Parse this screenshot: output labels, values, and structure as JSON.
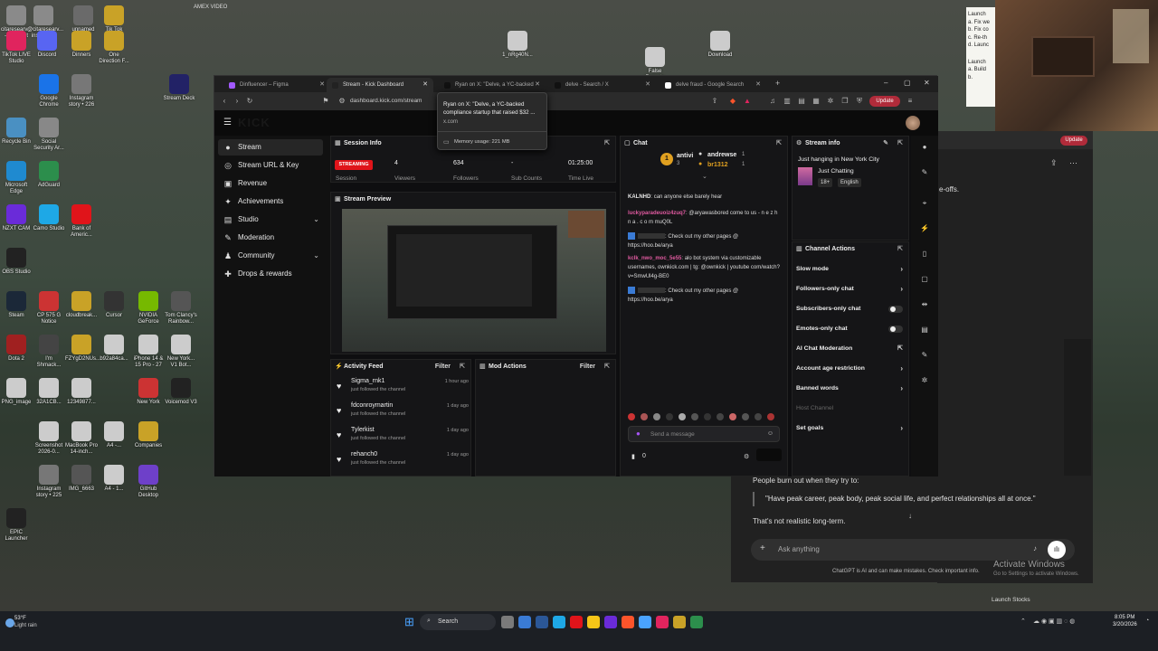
{
  "desktop": {
    "top_label": "AMEX VIDEO",
    "icons": [
      {
        "label": "citaresearv... - Shortcut",
        "color": "#8a8a8a"
      },
      {
        "label": "@citaresearv... instagram",
        "color": "#8a8a8a"
      },
      {
        "label": "unnamed",
        "color": "#6a6a6a"
      },
      {
        "label": "Tik Tok Videos",
        "color": "#c9a227"
      },
      {
        "label": "TikTok LIVE Studio",
        "color": "#e0245e"
      },
      {
        "label": "Discord",
        "color": "#5865f2"
      },
      {
        "label": "Dinners",
        "color": "#c9a227"
      },
      {
        "label": "One Direction F...",
        "color": "#c9a227"
      },
      {
        "label": "1_nRg40N...",
        "color": "#cccccc"
      },
      {
        "label": "False Reports",
        "color": "#cccccc"
      },
      {
        "label": "Download",
        "color": "#cccccc"
      },
      {
        "label": "Google Chrome",
        "color": "#1a73e8"
      },
      {
        "label": "Instagram story • 226",
        "color": "#777777"
      },
      {
        "label": "Stream Deck",
        "color": "#222266"
      },
      {
        "label": "Recycle Bin",
        "color": "#4a90c2"
      },
      {
        "label": "Social Security Ar...",
        "color": "#888888"
      },
      {
        "label": "Microsoft Edge",
        "color": "#1f8ad0"
      },
      {
        "label": "AdGuard",
        "color": "#2c8e4c"
      },
      {
        "label": "NZXT CAM",
        "color": "#6a2bd9"
      },
      {
        "label": "Camo Studio",
        "color": "#1ea8e6"
      },
      {
        "label": "Bank of Americ...",
        "color": "#e0141a"
      },
      {
        "label": "OBS Studio",
        "color": "#222222"
      },
      {
        "label": "Steam",
        "color": "#1b2838"
      },
      {
        "label": "CP 575 G Notice",
        "color": "#cc3333"
      },
      {
        "label": "cloudbreak...",
        "color": "#c9a227"
      },
      {
        "label": "Cursor",
        "color": "#333333"
      },
      {
        "label": "NVIDIA GeForce",
        "color": "#76b900"
      },
      {
        "label": "Tom Clancy's Rainbow...",
        "color": "#555555"
      },
      {
        "label": "Dota 2",
        "color": "#a02020"
      },
      {
        "label": "I'm Shmack...",
        "color": "#444444"
      },
      {
        "label": "FZYgD2NUs...",
        "color": "#c9a227"
      },
      {
        "label": "b92a84ca...",
        "color": "#cccccc"
      },
      {
        "label": "iPhone 14 & 15 Pro - 27",
        "color": "#cccccc"
      },
      {
        "label": "New York... V1 Bot...",
        "color": "#cccccc"
      },
      {
        "label": "PNG_image",
        "color": "#cccccc"
      },
      {
        "label": "32A1CB...",
        "color": "#cccccc"
      },
      {
        "label": "12349877...",
        "color": "#cccccc"
      },
      {
        "label": "New York",
        "color": "#cc3333"
      },
      {
        "label": "Voicemod V3",
        "color": "#222222"
      },
      {
        "label": "Screenshot 2026-0...",
        "color": "#cccccc"
      },
      {
        "label": "MacBook Pro 14-inch...",
        "color": "#cccccc"
      },
      {
        "label": "A4 -...",
        "color": "#cccccc"
      },
      {
        "label": "Companies",
        "color": "#c9a227"
      },
      {
        "label": "Instagram story • 225",
        "color": "#777777"
      },
      {
        "label": "IMG_6663",
        "color": "#555555"
      },
      {
        "label": "A4 - 1...",
        "color": "#cccccc"
      },
      {
        "label": "GitHub Desktop",
        "color": "#6e40c9"
      },
      {
        "label": "EPIC Launcher",
        "color": "#222222"
      }
    ]
  },
  "browser": {
    "tabs": [
      {
        "label": "Dinfluencer – Figma",
        "color": "#a259ff",
        "active": false
      },
      {
        "label": "Stream - Kick Dashboard",
        "color": "#222222",
        "active": true
      },
      {
        "label": "Ryan on X: \"Delve, a YC-backed",
        "color": "#111111",
        "active": false
      },
      {
        "label": "delve - Search / X",
        "color": "#111111",
        "active": false
      },
      {
        "label": "delve fraud - Google Search",
        "color": "#ffffff",
        "active": false
      }
    ],
    "new_tab": "+",
    "url": "dashboard.kick.com/stream",
    "update_label": "Update",
    "tooltip": {
      "title": "Ryan on X: \"Delve, a YC-backed compliance startup that raised $32 ...",
      "domain": "x.com",
      "memory": "Memory usage: 221 MB"
    }
  },
  "app": {
    "logo": "KICK",
    "nav": [
      {
        "label": "Stream",
        "icon": "●",
        "active": true,
        "expand": false
      },
      {
        "label": "Stream URL & Key",
        "icon": "◎",
        "active": false,
        "expand": false
      },
      {
        "label": "Revenue",
        "icon": "▣",
        "active": false,
        "expand": false
      },
      {
        "label": "Achievements",
        "icon": "✦",
        "active": false,
        "expand": false
      },
      {
        "label": "Studio",
        "icon": "▤",
        "active": false,
        "expand": true
      },
      {
        "label": "Moderation",
        "icon": "✎",
        "active": false,
        "expand": false
      },
      {
        "label": "Community",
        "icon": "♟",
        "active": false,
        "expand": true
      },
      {
        "label": "Drops & rewards",
        "icon": "✚",
        "active": false,
        "expand": false
      }
    ],
    "session": {
      "title": "Session Info",
      "status": "STREAMING",
      "status_sub": "Session",
      "viewers": "4",
      "viewers_label": "Viewers",
      "followers": "634",
      "followers_label": "Followers",
      "subs": "-",
      "subs_label": "Sub Counts",
      "time": "01:25:00",
      "time_label": "Time Live"
    },
    "preview": {
      "title": "Stream Preview"
    },
    "activity": {
      "title": "Activity Feed",
      "filter": "Filter",
      "items": [
        {
          "name": "Sigma_rnk1",
          "sub": "just followed the channel",
          "time": "1 hour ago"
        },
        {
          "name": "fdconroymartin",
          "sub": "just followed the channel",
          "time": "1 day ago"
        },
        {
          "name": "Tylerkist",
          "sub": "just followed the channel",
          "time": "1 day ago"
        },
        {
          "name": "rehanch0",
          "sub": "just followed the channel",
          "time": "1 day ago"
        }
      ]
    },
    "mod_actions": {
      "title": "Mod Actions",
      "filter": "Filter"
    },
    "chat": {
      "title": "Chat",
      "leaders": [
        {
          "rank": "1",
          "name": "antivi",
          "count": "3"
        },
        {
          "rank": "",
          "name": "andrewse",
          "count": "1"
        },
        {
          "rank": "",
          "name": "br1312",
          "count": "1"
        }
      ],
      "messages": [
        {
          "user": "KALNHD",
          "color": "#e6e6e6",
          "text": "can anyone else barely hear"
        },
        {
          "user": "luckyparadeuoiz4zuq7",
          "color": "#e05aa0",
          "text": "@aryawasbored come to us - n e z h n a . c o m muQ0L"
        },
        {
          "user": "",
          "color": "#e6e6e6",
          "text": ": Check out my other pages @ https://hoo.be/arya"
        },
        {
          "user": "kclk_nwo_moc_5e55",
          "color": "#e05aa0",
          "text": "alo bot system via customizable usernames, ownkick.com | tg: @ownkick | youtube com/watch?v=SmwUl4g-BE0"
        },
        {
          "user": "",
          "color": "#e6e6e6",
          "text": ": Check out my other pages @ https://hoo.be/arya"
        }
      ],
      "input_placeholder": "Send a message",
      "viewer_count": "0"
    },
    "stream_info": {
      "title": "Stream info",
      "stream_title": "Just hanging in New York City",
      "category": "Just Chatting",
      "tags": [
        "18+",
        "English"
      ]
    },
    "channel_actions": {
      "title": "Channel Actions",
      "items": [
        {
          "label": "Slow mode",
          "control": "arrow"
        },
        {
          "label": "Followers-only chat",
          "control": "arrow"
        },
        {
          "label": "Subscribers-only chat",
          "control": "toggle"
        },
        {
          "label": "Emotes-only chat",
          "control": "toggle"
        },
        {
          "label": "AI Chat Moderation",
          "control": "external"
        },
        {
          "label": "Account age restriction",
          "control": "arrow"
        },
        {
          "label": "Banned words",
          "control": "arrow"
        },
        {
          "label": "Host Channel",
          "control": "none"
        },
        {
          "label": "Set goals",
          "control": "arrow"
        }
      ]
    }
  },
  "chatgpt": {
    "snippet": "e-offs.",
    "intro": "People burn out when they try to:",
    "quote": "\"Have peak career, peak body, peak social life, and perfect relationships all at once.\"",
    "followup": "That's not realistic long-term.",
    "ask_placeholder": "Ask anything",
    "footer": "ChatGPT is AI and can make mistakes. Check important info.",
    "watermark_title": "Activate Windows",
    "watermark_sub": "Go to Settings to activate Windows.",
    "update_label": "Update"
  },
  "top_right_notes": {
    "lines": [
      "Launch",
      "a. Fix we",
      "b. Fix co",
      "c. Re-th",
      "d. Launc",
      "Launch",
      "a. Build",
      "b."
    ]
  },
  "taskbar": {
    "weather_temp": "53°F",
    "weather_desc": "Light rain",
    "search": "Search",
    "launch_stocks": "Launch Stocks",
    "time": "8:05 PM",
    "date": "3/20/2026"
  }
}
